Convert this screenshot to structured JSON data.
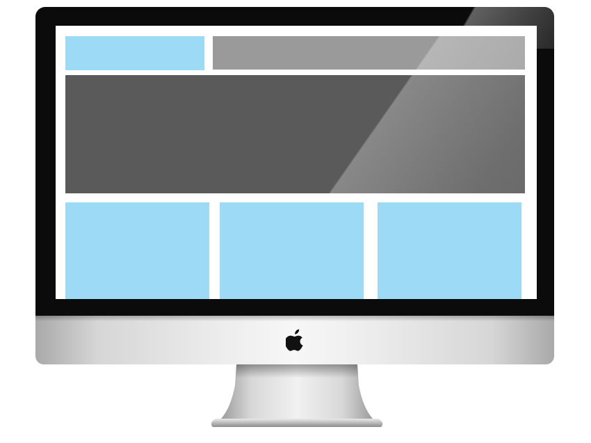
{
  "device": {
    "type": "desktop-monitor",
    "brand_icon": "apple-logo-icon",
    "colors": {
      "bezel": "#0b0b0b",
      "screen_background": "#ffffff",
      "accent_blue": "#9ddaf5",
      "nav_gray": "#9a9a9a",
      "hero_gray": "#5a5a5a",
      "aluminium": "#e6e6e6"
    }
  },
  "wireframe": {
    "header": {
      "logo_placeholder": "",
      "nav_placeholder": ""
    },
    "hero": {
      "placeholder": ""
    },
    "cards": [
      {
        "placeholder": ""
      },
      {
        "placeholder": ""
      },
      {
        "placeholder": ""
      }
    ]
  }
}
